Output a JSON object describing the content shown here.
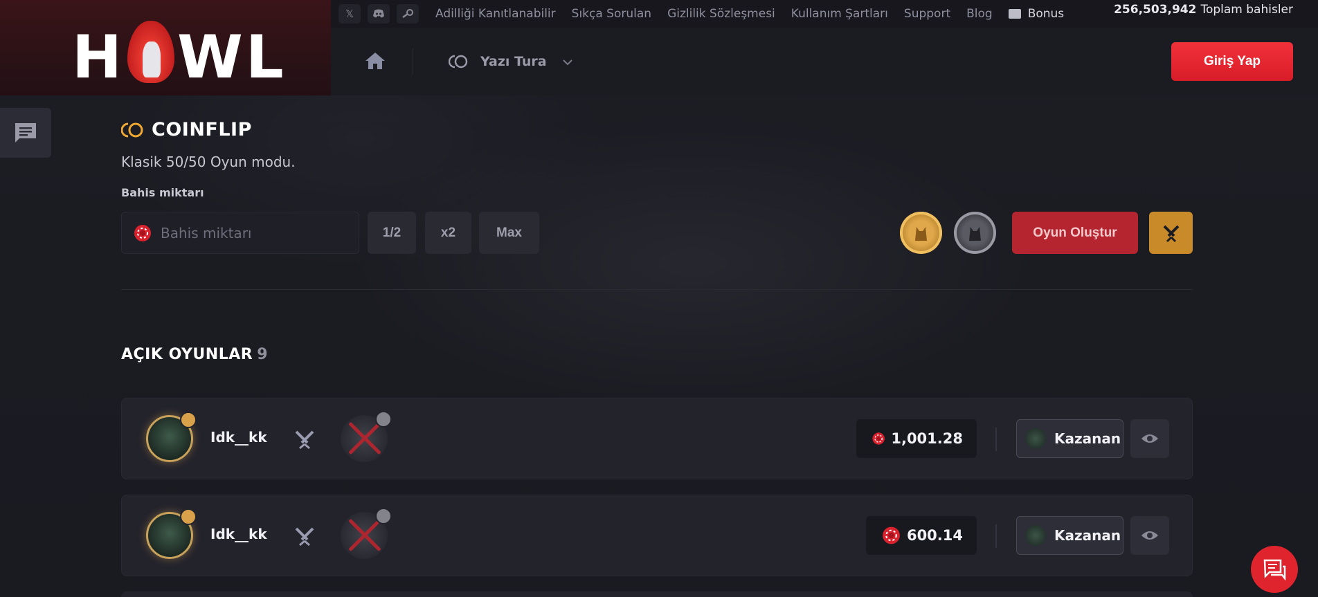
{
  "brand": {
    "logo_text_left": "H",
    "logo_text_right": "WL"
  },
  "topbar": {
    "social": [
      {
        "icon": "x-twitter-icon",
        "glyph": "𝕏"
      },
      {
        "icon": "discord-icon",
        "glyph": "◉"
      },
      {
        "icon": "steam-icon",
        "glyph": "⚙"
      }
    ],
    "links": [
      "Adilliği Kanıtlanabilir",
      "Sıkça Sorulan",
      "Gizlilik Sözleşmesi",
      "Kullanım Şartları",
      "Support",
      "Blog"
    ],
    "bonus_label": "Bonus",
    "total_bets_value": "256,503,942",
    "total_bets_label": "Toplam bahisler"
  },
  "nav": {
    "game_selector_label": "Yazı Tura",
    "login_label": "Giriş Yap"
  },
  "main": {
    "title": "COINFLIP",
    "subtitle": "Klasik 50/50 Oyun modu.",
    "bet_label": "Bahis miktarı",
    "bet_placeholder": "Bahis miktarı",
    "bet_value": "",
    "half_label": "1/2",
    "double_label": "x2",
    "max_label": "Max",
    "create_label": "Oyun Oluştur"
  },
  "open_games": {
    "title": "AÇIK OYUNLAR",
    "count": "9",
    "rows": [
      {
        "username": "Idk__kk",
        "amount": "1,001.28",
        "winner_label": "Kazanan"
      },
      {
        "username": "Idk__kk",
        "amount": "600.14",
        "winner_label": "Kazanan"
      }
    ]
  },
  "colors": {
    "accent_red": "#e0242e",
    "accent_gold": "#c98a2a",
    "bg": "#1a1a22"
  }
}
